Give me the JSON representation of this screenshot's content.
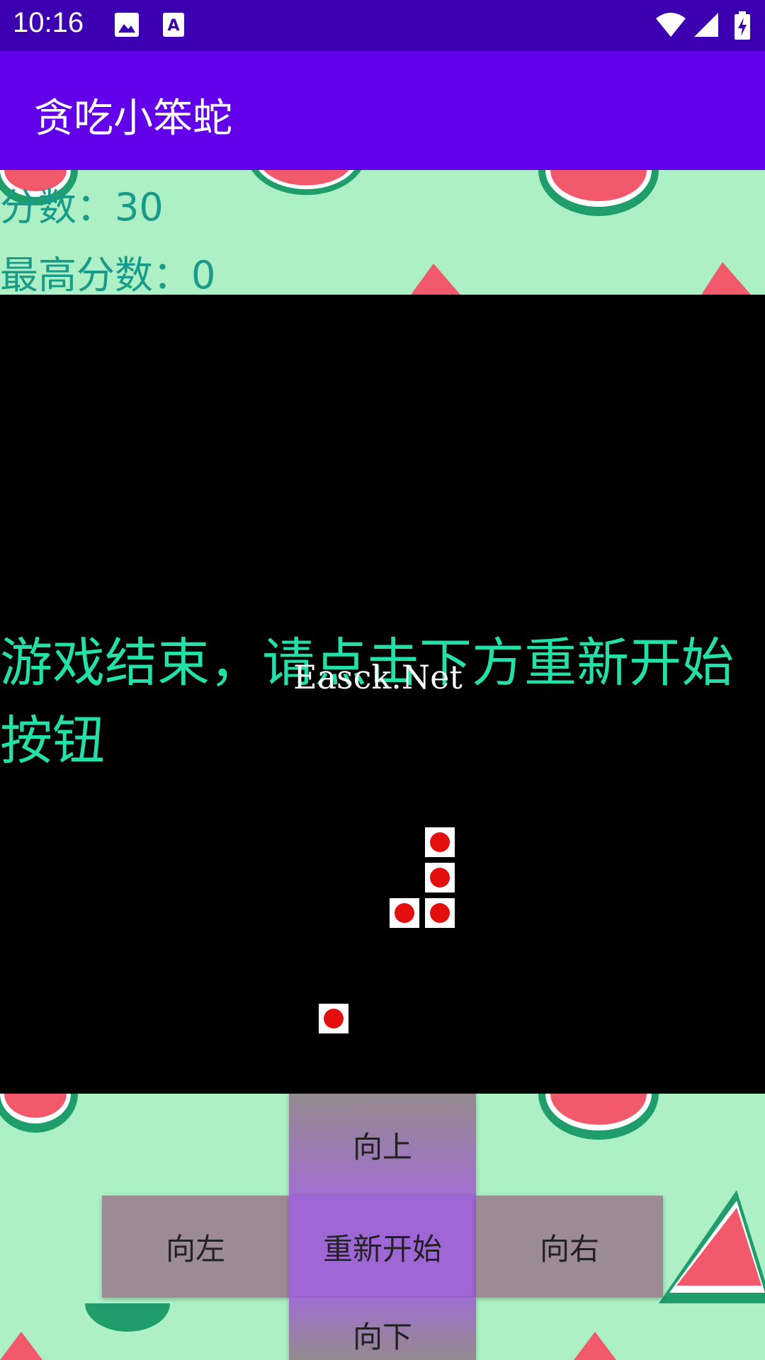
{
  "status_bar": {
    "time": "10:16"
  },
  "app_bar": {
    "title": "贪吃小笨蛇"
  },
  "scores": {
    "score": "分数：30",
    "high_score": "最高分数：0"
  },
  "game": {
    "message": "游戏结束，请点击下方重新开始按钮",
    "watermark": "Easck.Net"
  },
  "controls": {
    "up": "向上",
    "left": "向左",
    "restart": "重新开始",
    "right": "向右",
    "down": "向下"
  },
  "colors": {
    "app_bar": "#6200ea",
    "status_bar": "#3d00b0",
    "message": "#22e0a8",
    "score_text": "#1a9a88"
  }
}
